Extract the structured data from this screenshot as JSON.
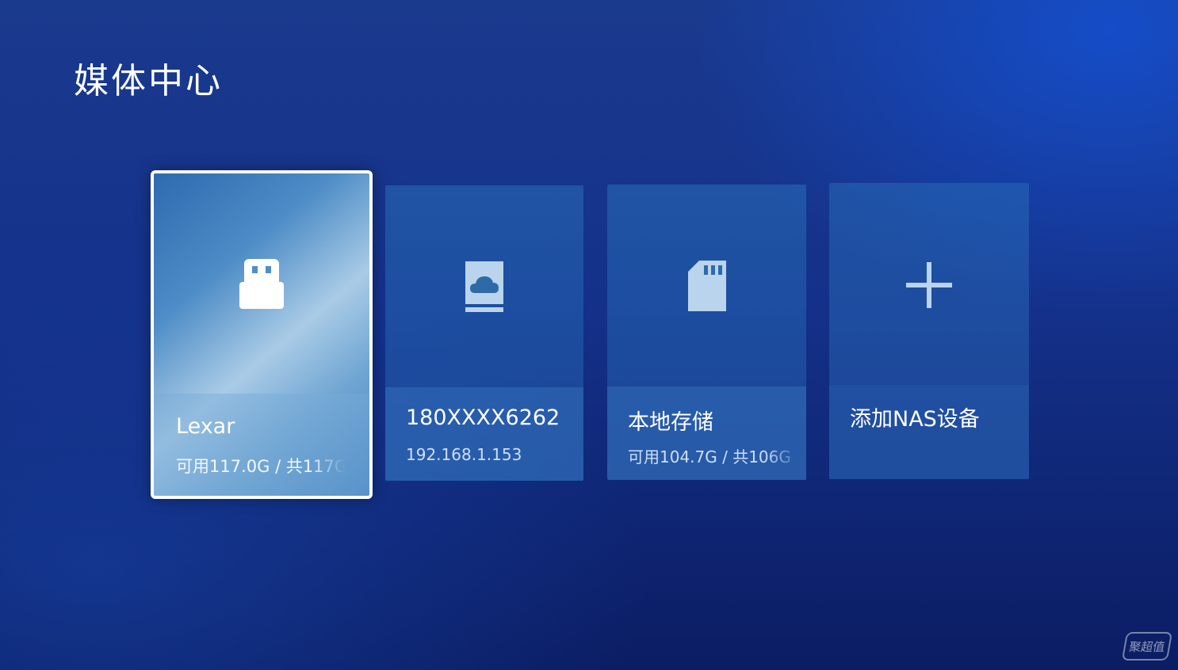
{
  "header": {
    "title": "媒体中心"
  },
  "cards": [
    {
      "name": "Lexar",
      "sub": "可用117.0G / 共117G",
      "icon": "usb-drive-icon",
      "focused": true
    },
    {
      "name": "180XXXX6262",
      "sub": "192.168.1.153",
      "icon": "cloud-storage-icon",
      "focused": false
    },
    {
      "name": "本地存储",
      "sub": "可用104.7G / 共106G",
      "icon": "sd-card-icon",
      "focused": false
    },
    {
      "name": "添加NAS设备",
      "sub": "",
      "icon": "plus-icon",
      "focused": false
    }
  ],
  "watermark": {
    "text": "聚超值"
  },
  "colors": {
    "background": "#14318a",
    "card": "#2f6fb8",
    "focus_border": "#ffffff",
    "icon": "#ffffff"
  }
}
